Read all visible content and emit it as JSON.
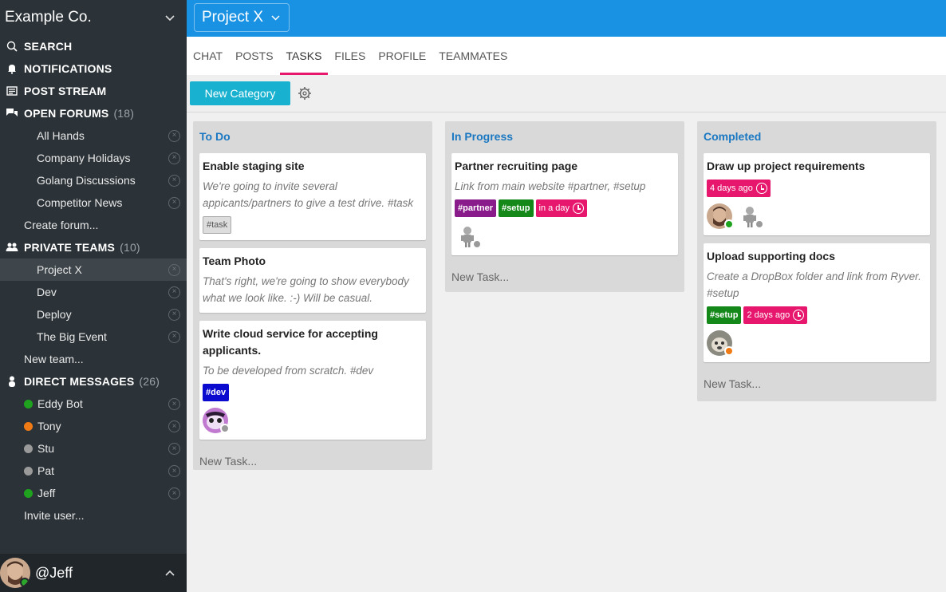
{
  "org": {
    "name": "Example Co."
  },
  "nav": {
    "search": "SEARCH",
    "notifications": "NOTIFICATIONS",
    "post_stream": "POST STREAM",
    "open_forums": {
      "label": "OPEN FORUMS",
      "count": "(18)"
    },
    "forums": [
      "All Hands",
      "Company Holidays",
      "Golang Discussions",
      "Competitor News"
    ],
    "create_forum": "Create forum...",
    "private_teams": {
      "label": "PRIVATE TEAMS",
      "count": "(10)"
    },
    "teams": [
      "Project X",
      "Dev",
      "Deploy",
      "The Big Event"
    ],
    "new_team": "New team...",
    "direct_messages": {
      "label": "DIRECT MESSAGES",
      "count": "(26)"
    },
    "dms": [
      {
        "name": "Eddy Bot",
        "status_color": "#1fa31f"
      },
      {
        "name": "Tony",
        "status_color": "#f07a14"
      },
      {
        "name": "Stu",
        "status_color": "#9a9a9a"
      },
      {
        "name": "Pat",
        "status_color": "#9a9a9a"
      },
      {
        "name": "Jeff",
        "status_color": "#1fa31f"
      }
    ],
    "invite_user": "Invite user...",
    "close_glyph": "×"
  },
  "user": {
    "handle": "@Jeff"
  },
  "header": {
    "project": "Project X"
  },
  "tabs": [
    "CHAT",
    "POSTS",
    "TASKS",
    "FILES",
    "PROFILE",
    "TEAMMATES"
  ],
  "toolbar": {
    "new_category": "New Category"
  },
  "board": {
    "columns": [
      {
        "title": "To Do",
        "cards": [
          {
            "title": "Enable staging site",
            "desc": "We're going to invite several appicants/partners to give a test drive. #task",
            "tags": [
              "#task"
            ]
          },
          {
            "title": "Team Photo",
            "desc": "That's right, we're going to show everybody what we look like. :-) Will be casual."
          },
          {
            "title": "Write cloud service for accepting applicants.",
            "desc": "To be developed from scratch. #dev",
            "tags": [
              "#dev"
            ]
          }
        ],
        "new_task": "New Task..."
      },
      {
        "title": "In Progress",
        "cards": [
          {
            "title": "Partner recruiting page",
            "desc": "Link from main website #partner, #setup",
            "tags": [
              "#partner",
              "#setup"
            ],
            "due": "in a day"
          }
        ],
        "new_task": "New Task..."
      },
      {
        "title": "Completed",
        "cards": [
          {
            "title": "Draw up project requirements",
            "due": "4 days ago"
          },
          {
            "title": "Upload supporting docs",
            "desc": "Create a DropBox folder and link from Ryver. #setup",
            "tags": [
              "#setup"
            ],
            "due": "2 days ago"
          }
        ],
        "new_task": "New Task..."
      }
    ]
  },
  "colors": {
    "accent_blue": "#1a92e3",
    "sidebar": "#2c3338",
    "tab_underline": "#e6176d",
    "button": "#18b2d0"
  }
}
